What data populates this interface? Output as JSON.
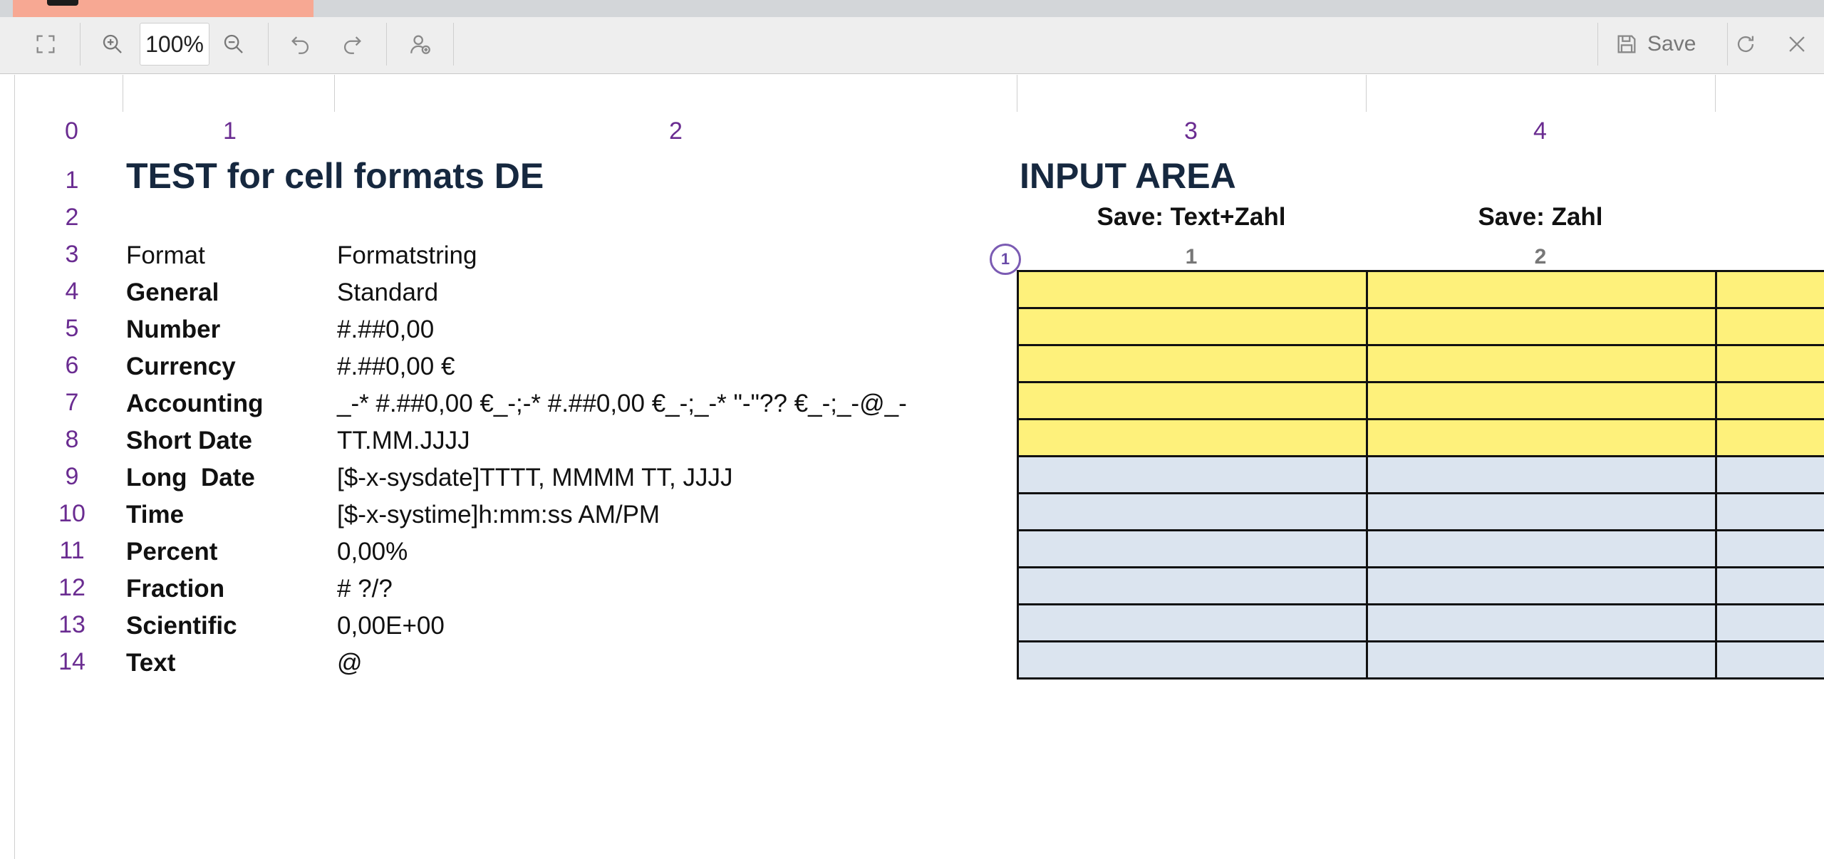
{
  "toolbar": {
    "zoom": "100%",
    "save_label": "Save",
    "icons": [
      "fullscreen-icon",
      "zoom-in-icon",
      "zoom-out-icon",
      "undo-icon",
      "redo-icon",
      "add-user-icon",
      "save-icon",
      "refresh-icon",
      "close-icon"
    ]
  },
  "sheet": {
    "column_headers": [
      "0",
      "1",
      "2",
      "3",
      "4"
    ],
    "row_numbers": [
      "1",
      "2",
      "3",
      "4",
      "5",
      "6",
      "7",
      "8",
      "9",
      "10",
      "11",
      "12",
      "13",
      "14"
    ],
    "title": "TEST for cell formats DE",
    "input_area_title": "INPUT AREA",
    "input_headers": [
      "Save: Text+Zahl",
      "Save: Zahl"
    ],
    "input_col_numbers": [
      "1",
      "2"
    ],
    "badge": "1",
    "header_row": {
      "format": "Format",
      "formatstring": "Formatstring"
    },
    "rows": [
      {
        "format": "General",
        "formatstring": "Standard"
      },
      {
        "format": "Number",
        "formatstring": "#.##0,00"
      },
      {
        "format": "Currency",
        "formatstring": "#.##0,00 €"
      },
      {
        "format": "Accounting",
        "formatstring": "_-* #.##0,00 €_-;-* #.##0,00 €_-;_-* \"-\"?? €_-;_-@_-"
      },
      {
        "format": "Short Date",
        "formatstring": "TT.MM.JJJJ"
      },
      {
        "format": "Long  Date",
        "formatstring": "[$-x-sysdate]TTTT, MMMM TT, JJJJ"
      },
      {
        "format": "Time",
        "formatstring": "[$-x-systime]h:mm:ss AM/PM"
      },
      {
        "format": "Percent",
        "formatstring": "0,00%"
      },
      {
        "format": "Fraction",
        "formatstring": "# ?/?"
      },
      {
        "format": "Scientific",
        "formatstring": "0,00E+00"
      },
      {
        "format": "Text",
        "formatstring": "@"
      }
    ],
    "input_rows": {
      "yellow_count": 5,
      "blue_count": 6
    },
    "colors": {
      "row_header": "#6a2c91",
      "title": "#16283f",
      "input_yellow": "#fef17b",
      "input_blue": "#dbe4ef",
      "active_tab": "#f7a893"
    }
  }
}
